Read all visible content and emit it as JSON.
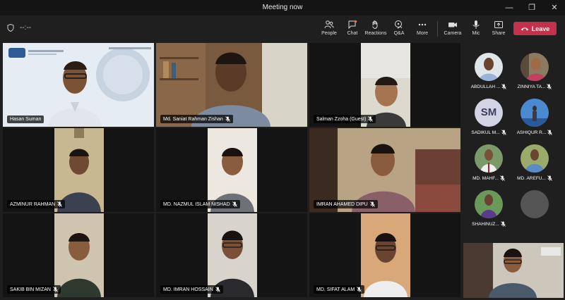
{
  "window": {
    "title": "Meeting now",
    "min_glyph": "—",
    "max_glyph": "❐",
    "close_glyph": "✕"
  },
  "toolbar": {
    "timer": "--:--",
    "people": "People",
    "chat": "Chat",
    "reactions": "Reactions",
    "qa": "Q&A",
    "more": "More",
    "camera": "Camera",
    "mic": "Mic",
    "share": "Share",
    "leave": "Leave"
  },
  "participants": [
    {
      "name": "Hasan Suman"
    },
    {
      "name": "Md. Saniat Rahman Zishan"
    },
    {
      "name": "Salman Zzoha (Guest)"
    },
    {
      "name": "AZMINUR RAHMAN"
    },
    {
      "name": "MD. NAZMUL ISLAM NISHAD"
    },
    {
      "name": "IMRAN AHAMED DIPU"
    },
    {
      "name": "SAKIB BIN MIZAN"
    },
    {
      "name": "MD. IMRAN HOSSAIN"
    },
    {
      "name": "MD. SIFAT ALAM"
    }
  ],
  "roster": [
    {
      "name": "ABDULLAH ...",
      "initials": ""
    },
    {
      "name": "ZINNIYA TA...",
      "initials": ""
    },
    {
      "name": "SADIKUL M...",
      "initials": "SM"
    },
    {
      "name": "ASHIQUR R...",
      "initials": ""
    },
    {
      "name": "MD. MAHF...",
      "initials": ""
    },
    {
      "name": "MD. AREFU...",
      "initials": ""
    },
    {
      "name": "SHAHINUZ...",
      "initials": ""
    }
  ],
  "colors": {
    "leave": "#c4314b",
    "background": "#1f1f1f",
    "titlebar": "#141414"
  }
}
